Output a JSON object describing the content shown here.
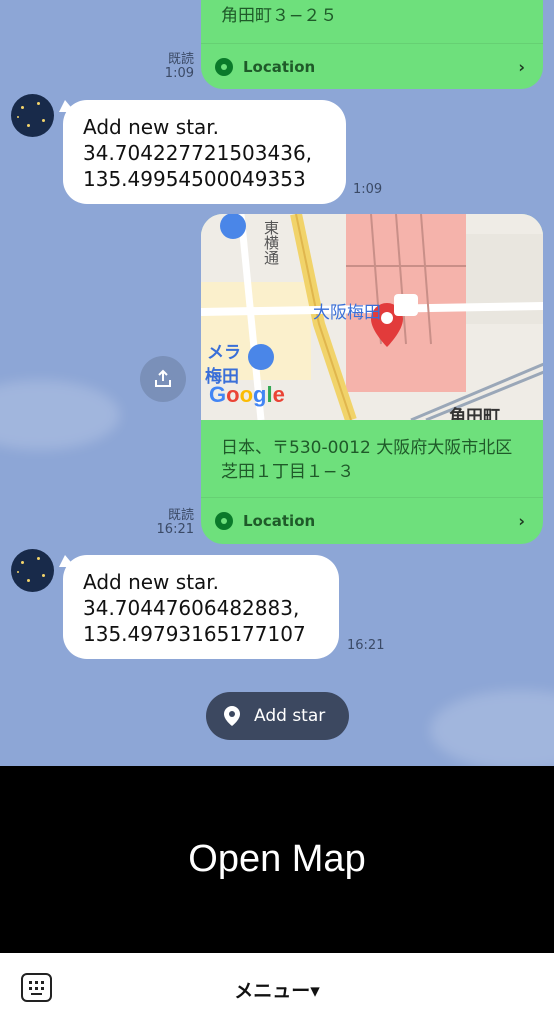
{
  "messages": {
    "first_location": {
      "address_tail": "角田町３−２５",
      "link_label": "Location",
      "read": "既読",
      "time": "1:09"
    },
    "star1": {
      "line1": "Add new star.",
      "line2": "34.704227721503436,",
      "line3": "135.49954500049353",
      "time": "1:09"
    },
    "second_location": {
      "map_labels": {
        "google": "Google",
        "osaka_umeda": "大阪梅田",
        "kakuda": "角田町",
        "camera_umeda": "メラ",
        "umeda": "梅田",
        "higashi": "東横通"
      },
      "address_line1": "日本、〒530-0012 大阪府大阪市北区",
      "address_line2": "芝田１丁目１−３",
      "link_label": "Location",
      "read": "既読",
      "time": "16:21"
    },
    "star2": {
      "line1": "Add new star.",
      "line2": "34.70447606482883,",
      "line3": "135.49793165177107",
      "time": "16:21"
    }
  },
  "actions": {
    "add_star_label": "Add star",
    "open_map_label": "Open Map"
  },
  "bottom_bar": {
    "menu_label": "メニュー▾"
  },
  "colors": {
    "chat_bg": "#8da6d6",
    "location_bubble": "#6ee07c",
    "map_pin": "#e23b3b"
  }
}
